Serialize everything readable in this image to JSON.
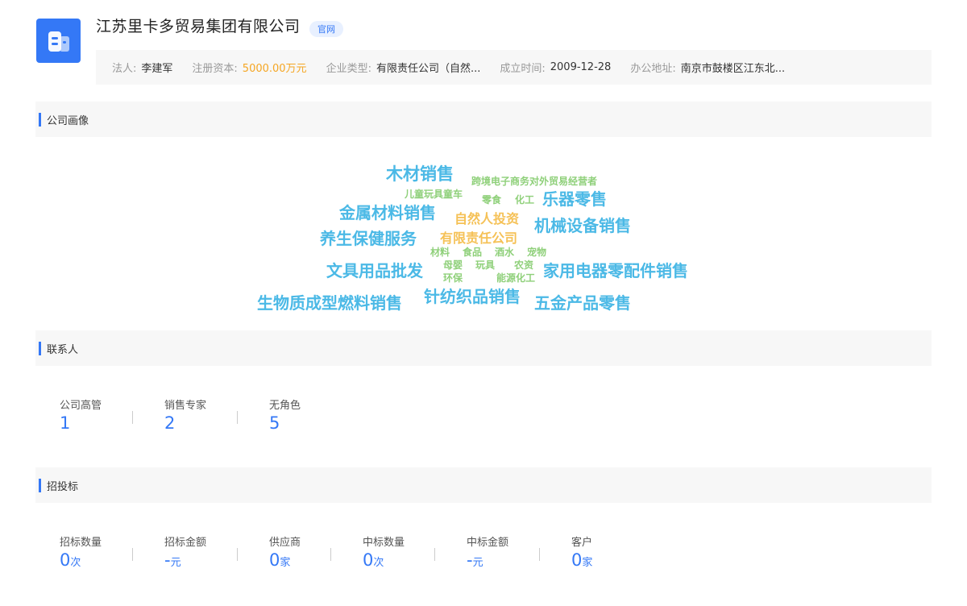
{
  "company": {
    "name": "江苏里卡多贸易集团有限公司",
    "tag": "官网"
  },
  "info": {
    "legal_label": "法人:",
    "legal_value": "李建军",
    "capital_label": "注册资本:",
    "capital_value": "5000.00万元",
    "type_label": "企业类型:",
    "type_value": "有限责任公司（自然...",
    "founded_label": "成立时间:",
    "founded_value": "2009-12-28",
    "address_label": "办公地址:",
    "address_value": "南京市鼓楼区江东北..."
  },
  "sections": {
    "portrait": "公司画像",
    "contacts": "联系人",
    "bidding": "招投标"
  },
  "cloud_words": [
    "木材销售",
    "跨境电子商务对外贸易经营者",
    "儿童玩具童车",
    "零食",
    "化工",
    "乐器零售",
    "金属材料销售",
    "自然人投资",
    "机械设备销售",
    "养生保健服务",
    "有限责任公司",
    "材料",
    "食品",
    "酒水",
    "宠物",
    "文具用品批发",
    "母婴",
    "玩具",
    "农资",
    "家用电器零配件销售",
    "环保",
    "能源化工",
    "生物质成型燃料销售",
    "针纺织品销售",
    "五金产品零售"
  ],
  "contacts": [
    {
      "label": "公司高管",
      "value": "1"
    },
    {
      "label": "销售专家",
      "value": "2"
    },
    {
      "label": "无角色",
      "value": "5"
    }
  ],
  "bidding": [
    {
      "label": "招标数量",
      "value": "0",
      "unit": "次"
    },
    {
      "label": "招标金额",
      "value": "-",
      "unit": "元"
    },
    {
      "label": "供应商",
      "value": "0",
      "unit": "家"
    },
    {
      "label": "中标数量",
      "value": "0",
      "unit": "次"
    },
    {
      "label": "中标金额",
      "value": "-",
      "unit": "元"
    },
    {
      "label": "客户",
      "value": "0",
      "unit": "家"
    }
  ],
  "colors": {
    "accent": "#3478f6",
    "cloud_blue": "#4bb9e6",
    "cloud_green": "#8fd07a",
    "cloud_gold": "#f5c156",
    "capital": "#f5a623"
  }
}
